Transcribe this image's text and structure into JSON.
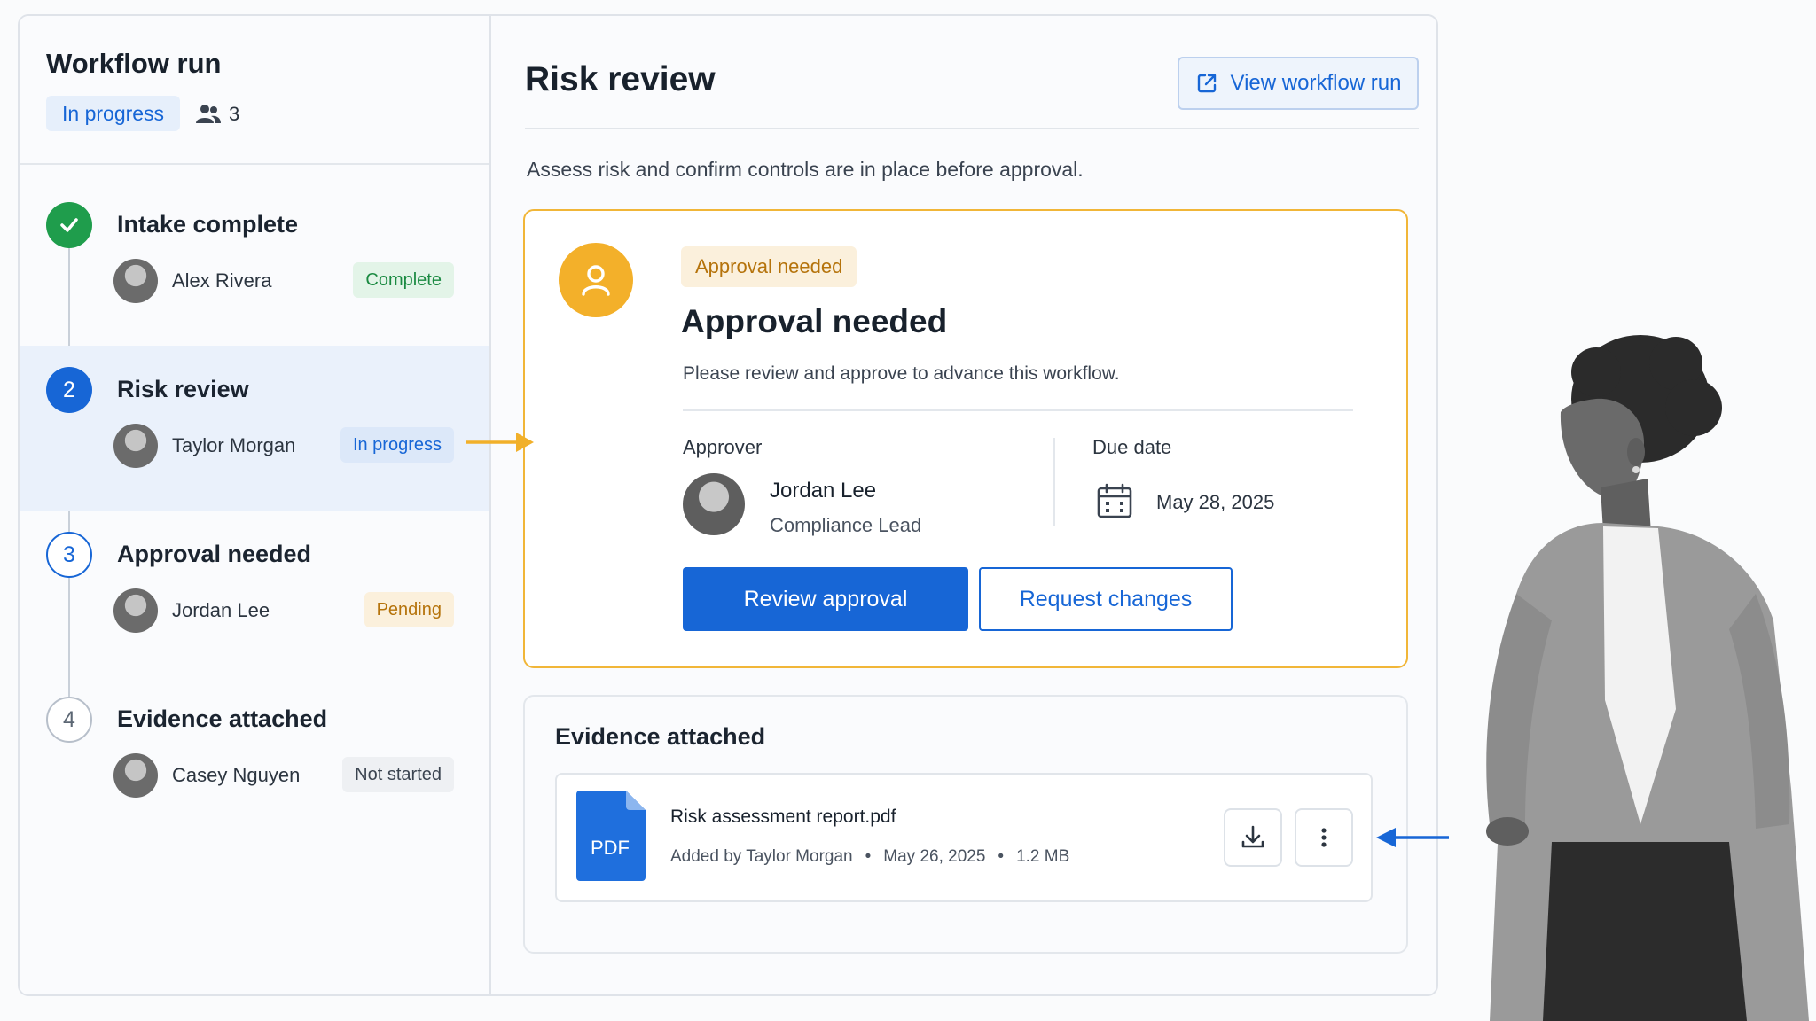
{
  "sidebar": {
    "title": "Workflow run",
    "status": "In progress",
    "participants_count": "3",
    "steps": [
      {
        "number": "",
        "title": "Intake complete",
        "assignee": "Alex Rivera",
        "status": "Complete"
      },
      {
        "number": "2",
        "title": "Risk review",
        "assignee": "Taylor Morgan",
        "status": "In progress"
      },
      {
        "number": "3",
        "title": "Approval needed",
        "assignee": "Jordan Lee",
        "status": "Pending"
      },
      {
        "number": "4",
        "title": "Evidence attached",
        "assignee": "Casey Nguyen",
        "status": "Not started"
      }
    ]
  },
  "main": {
    "title": "Risk review",
    "view_button": "View workflow run",
    "description": "Assess risk and confirm controls are in place before approval.",
    "approval": {
      "badge": "Approval needed",
      "title": "Approval needed",
      "description": "Please review and approve to advance this workflow.",
      "approver_label": "Approver",
      "approver_name": "Jordan Lee",
      "approver_role": "Compliance Lead",
      "due_label": "Due date",
      "due_date": "May 28, 2025",
      "primary_button": "Review approval",
      "secondary_button": "Request changes"
    },
    "evidence": {
      "title": "Evidence attached",
      "file": {
        "icon_label": "PDF",
        "name": "Risk assessment report.pdf",
        "added_by": "Added by Taylor Morgan",
        "date": "May 26, 2025",
        "size": "1.2 MB"
      }
    }
  },
  "colors": {
    "accent": "#1766d6",
    "success": "#1f9d4c",
    "warning": "#f3b02a",
    "highlight": "#eaf1fb"
  },
  "icons": {
    "people": "people-icon",
    "external_link": "external-link-icon",
    "check": "check-icon",
    "user": "user-icon",
    "calendar": "calendar-icon",
    "pdf": "pdf-file-icon",
    "download": "download-icon",
    "more": "more-vertical-icon"
  }
}
